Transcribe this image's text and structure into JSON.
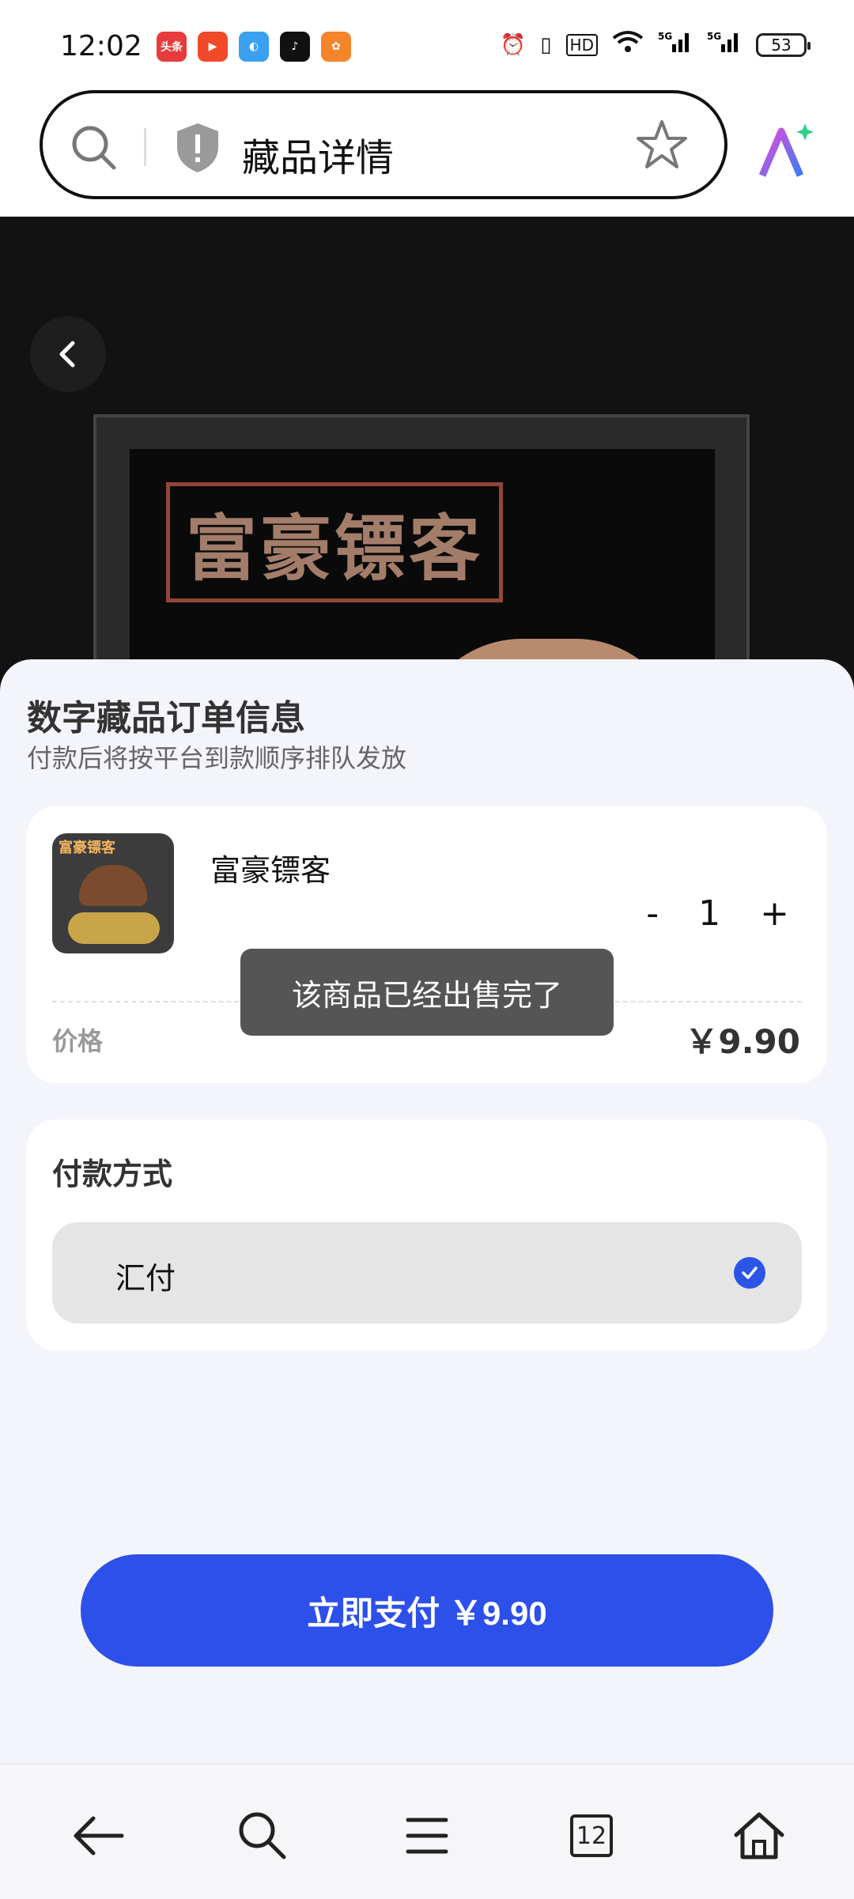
{
  "status": {
    "time": "12:02",
    "apps": [
      {
        "name": "toutiao",
        "label": "头条",
        "color": "#e83b3b"
      },
      {
        "name": "video",
        "label": "▶",
        "color": "#f04a2a"
      },
      {
        "name": "browser",
        "label": "◐",
        "color": "#3aa0f0"
      },
      {
        "name": "douyin",
        "label": "♪",
        "color": "#111111"
      },
      {
        "name": "game",
        "label": "✿",
        "color": "#f5852a"
      }
    ],
    "network": "5G",
    "battery": "53"
  },
  "browser": {
    "title": "藏品详情"
  },
  "sheet": {
    "title": "数字藏品订单信息",
    "subtitle": "付款后将按平台到款顺序排队发放",
    "neon_text": "富豪镖客"
  },
  "order": {
    "product_name": "富豪镖客",
    "thumb_text": "富豪镖客",
    "minus": "-",
    "quantity": "1",
    "plus": "+",
    "price_label": "价格",
    "price": "￥9.90"
  },
  "payment": {
    "title": "付款方式",
    "method": "汇付"
  },
  "pay_button": "立即支付 ￥9.90",
  "toast": "该商品已经出售完了",
  "nav": {
    "tab_count": "12"
  }
}
